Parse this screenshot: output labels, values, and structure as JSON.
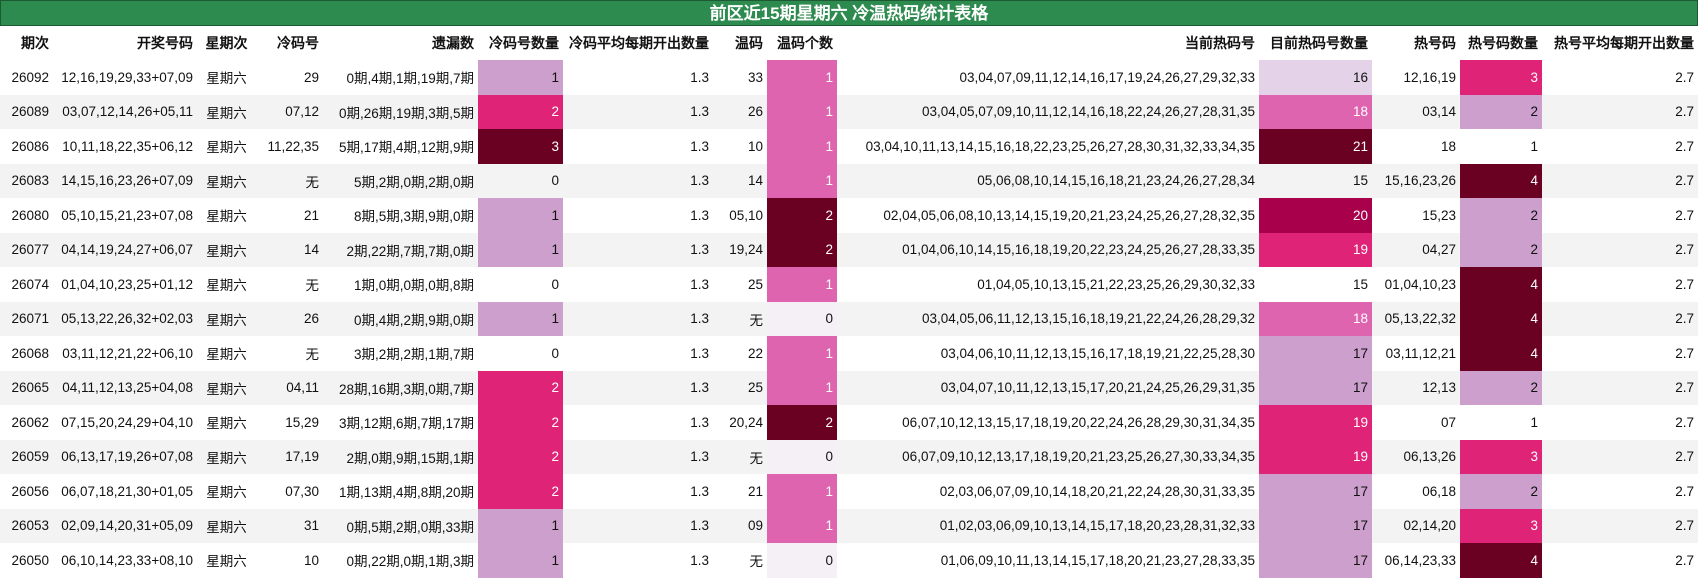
{
  "title": "前区近15期星期六 冷温热码统计表格",
  "headers": [
    "期次",
    "开奖号码",
    "星期次",
    "冷码号",
    "遗漏数",
    "冷码号数量",
    "冷码平均每期开出数量",
    "温码",
    "温码个数",
    "当前热码号",
    "目前热码号数量",
    "热号码",
    "热号码数量",
    "热号平均每期开出数量"
  ],
  "colors": {
    "title_bg": "#2e8b4f",
    "cold": {
      "0": "",
      "1": "#cc9fcc",
      "2": "#df2478",
      "3": "#6a0022"
    },
    "warm": {
      "0": "#f5f0f6",
      "1": "#de64b0",
      "2": "#6a0022"
    },
    "hotcount": {
      "15": "",
      "16": "#e4d3e8",
      "17": "#cc9fcc",
      "18": "#de64b0",
      "19": "#df2478",
      "20": "#a8004a",
      "21": "#6a0022"
    },
    "hot": {
      "1": "",
      "2": "#cc9fcc",
      "3": "#df2478",
      "4": "#6a0022"
    }
  },
  "rows": [
    [
      "26092",
      "12,16,19,29,33+07,09",
      "星期六",
      "29",
      "0期,4期,1期,19期,7期",
      "1",
      "1.3",
      "33",
      "1",
      "03,04,07,09,11,12,14,16,17,19,24,26,27,29,32,33",
      "16",
      "12,16,19",
      "3",
      "2.7"
    ],
    [
      "26089",
      "03,07,12,14,26+05,11",
      "星期六",
      "07,12",
      "0期,26期,19期,3期,5期",
      "2",
      "1.3",
      "26",
      "1",
      "03,04,05,07,09,10,11,12,14,16,18,22,24,26,27,28,31,35",
      "18",
      "03,14",
      "2",
      "2.7"
    ],
    [
      "26086",
      "10,11,18,22,35+06,12",
      "星期六",
      "11,22,35",
      "5期,17期,4期,12期,9期",
      "3",
      "1.3",
      "10",
      "1",
      "03,04,10,11,13,14,15,16,18,22,23,25,26,27,28,30,31,32,33,34,35",
      "21",
      "18",
      "1",
      "2.7"
    ],
    [
      "26083",
      "14,15,16,23,26+07,09",
      "星期六",
      "无",
      "5期,2期,0期,2期,0期",
      "0",
      "1.3",
      "14",
      "1",
      "05,06,08,10,14,15,16,18,21,23,24,26,27,28,34",
      "15",
      "15,16,23,26",
      "4",
      "2.7"
    ],
    [
      "26080",
      "05,10,15,21,23+07,08",
      "星期六",
      "21",
      "8期,5期,3期,9期,0期",
      "1",
      "1.3",
      "05,10",
      "2",
      "02,04,05,06,08,10,13,14,15,19,20,21,23,24,25,26,27,28,32,35",
      "20",
      "15,23",
      "2",
      "2.7"
    ],
    [
      "26077",
      "04,14,19,24,27+06,07",
      "星期六",
      "14",
      "2期,22期,7期,7期,0期",
      "1",
      "1.3",
      "19,24",
      "2",
      "01,04,06,10,14,15,16,18,19,20,22,23,24,25,26,27,28,33,35",
      "19",
      "04,27",
      "2",
      "2.7"
    ],
    [
      "26074",
      "01,04,10,23,25+01,12",
      "星期六",
      "无",
      "1期,0期,0期,0期,8期",
      "0",
      "1.3",
      "25",
      "1",
      "01,04,05,10,13,15,21,22,23,25,26,29,30,32,33",
      "15",
      "01,04,10,23",
      "4",
      "2.7"
    ],
    [
      "26071",
      "05,13,22,26,32+02,03",
      "星期六",
      "26",
      "0期,4期,2期,9期,0期",
      "1",
      "1.3",
      "无",
      "0",
      "03,04,05,06,11,12,13,15,16,18,19,21,22,24,26,28,29,32",
      "18",
      "05,13,22,32",
      "4",
      "2.7"
    ],
    [
      "26068",
      "03,11,12,21,22+06,10",
      "星期六",
      "无",
      "3期,2期,2期,1期,7期",
      "0",
      "1.3",
      "22",
      "1",
      "03,04,06,10,11,12,13,15,16,17,18,19,21,22,25,28,30",
      "17",
      "03,11,12,21",
      "4",
      "2.7"
    ],
    [
      "26065",
      "04,11,12,13,25+04,08",
      "星期六",
      "04,11",
      "28期,16期,3期,0期,7期",
      "2",
      "1.3",
      "25",
      "1",
      "03,04,07,10,11,12,13,15,17,20,21,24,25,26,29,31,35",
      "17",
      "12,13",
      "2",
      "2.7"
    ],
    [
      "26062",
      "07,15,20,24,29+04,10",
      "星期六",
      "15,29",
      "3期,12期,6期,7期,17期",
      "2",
      "1.3",
      "20,24",
      "2",
      "06,07,10,12,13,15,17,18,19,20,22,24,26,28,29,30,31,34,35",
      "19",
      "07",
      "1",
      "2.7"
    ],
    [
      "26059",
      "06,13,17,19,26+07,08",
      "星期六",
      "17,19",
      "2期,0期,9期,15期,1期",
      "2",
      "1.3",
      "无",
      "0",
      "06,07,09,10,12,13,17,18,19,20,21,23,25,26,27,30,33,34,35",
      "19",
      "06,13,26",
      "3",
      "2.7"
    ],
    [
      "26056",
      "06,07,18,21,30+01,05",
      "星期六",
      "07,30",
      "1期,13期,4期,8期,20期",
      "2",
      "1.3",
      "21",
      "1",
      "02,03,06,07,09,10,14,18,20,21,22,24,28,30,31,33,35",
      "17",
      "06,18",
      "2",
      "2.7"
    ],
    [
      "26053",
      "02,09,14,20,31+05,09",
      "星期六",
      "31",
      "0期,5期,2期,0期,33期",
      "1",
      "1.3",
      "09",
      "1",
      "01,02,03,06,09,10,13,14,15,17,18,20,23,28,31,32,33",
      "17",
      "02,14,20",
      "3",
      "2.7"
    ],
    [
      "26050",
      "06,10,14,23,33+08,10",
      "星期六",
      "10",
      "0期,22期,0期,1期,3期",
      "1",
      "1.3",
      "无",
      "0",
      "01,06,09,10,11,13,14,15,17,18,20,21,23,27,28,33,35",
      "17",
      "06,14,23,33",
      "4",
      "2.7"
    ]
  ]
}
